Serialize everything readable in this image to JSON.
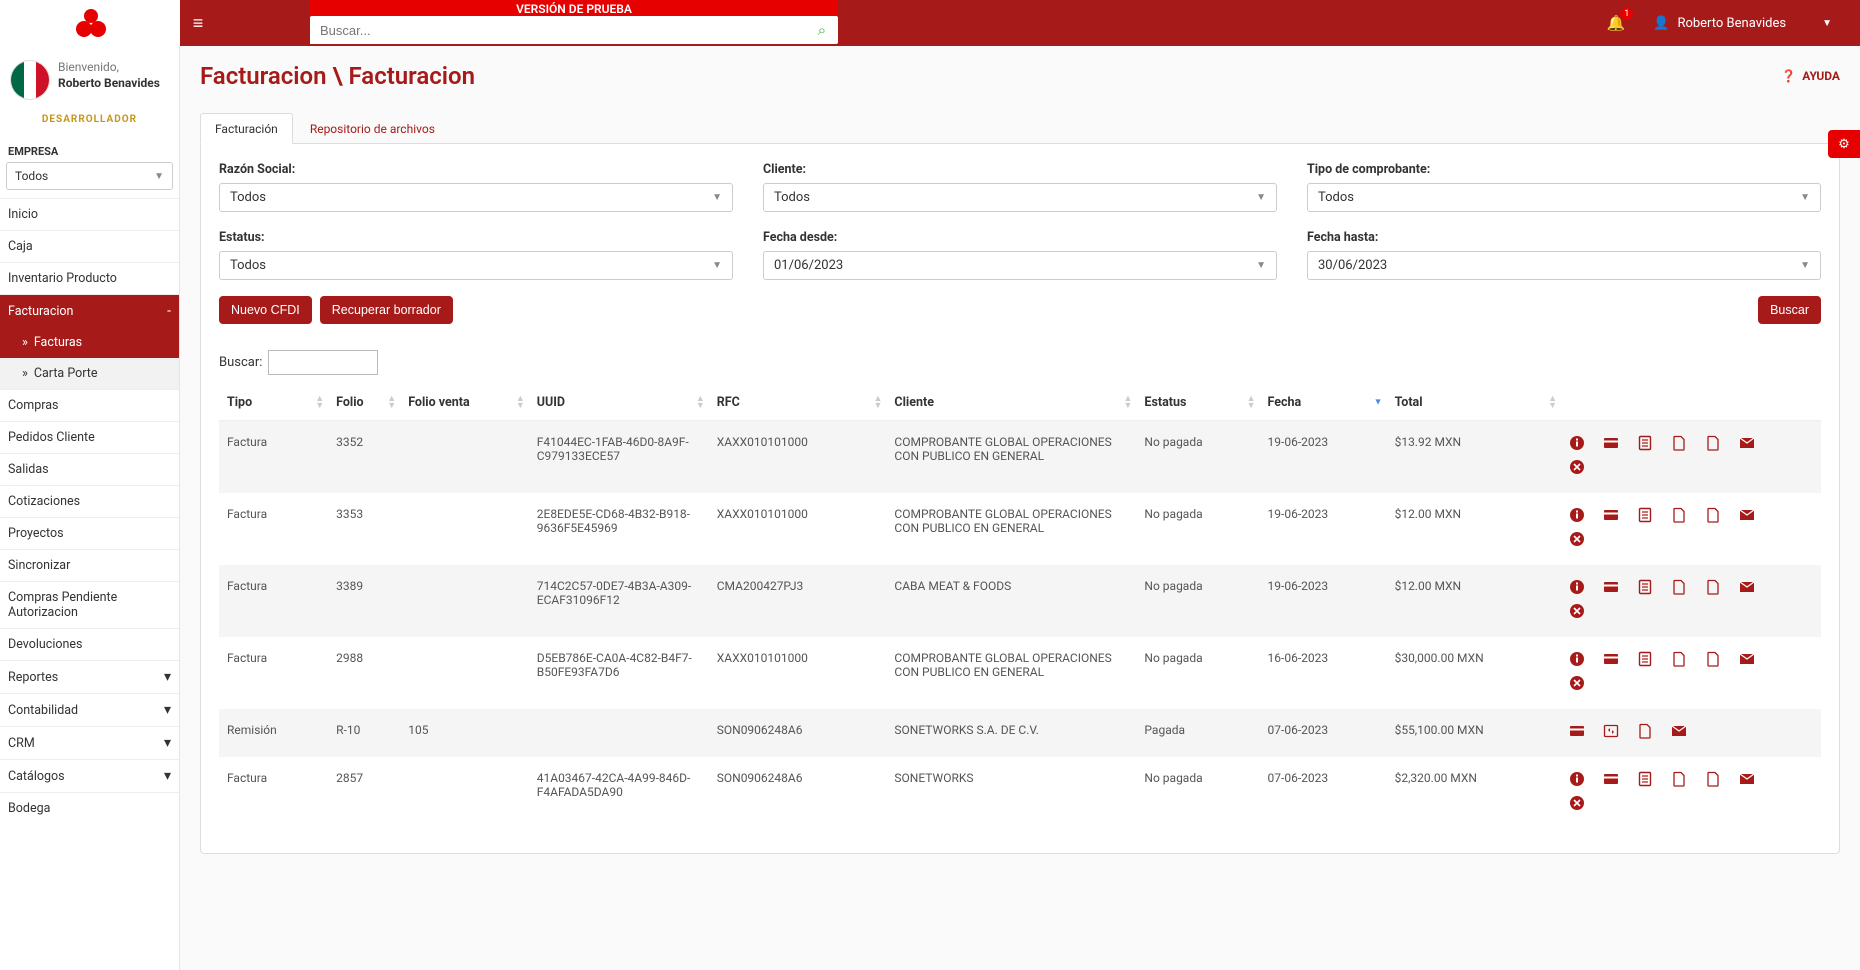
{
  "topbar": {
    "version_banner": "VERSIÓN DE PRUEBA",
    "search_placeholder": "Buscar...",
    "notification_count": "1",
    "user_name": "Roberto Benavides"
  },
  "greeting": {
    "welcome": "Bienvenido,",
    "user_name": "Roberto Benavides",
    "role": "DESARROLLADOR"
  },
  "company": {
    "label": "EMPRESA",
    "value": "Todos"
  },
  "nav": {
    "items": [
      {
        "label": "Inicio",
        "active": false,
        "expand": null
      },
      {
        "label": "Caja",
        "active": false,
        "expand": null
      },
      {
        "label": "Inventario Producto",
        "active": false,
        "expand": null
      },
      {
        "label": "Facturacion",
        "active": true,
        "expand": "-"
      },
      {
        "label": "Compras",
        "active": false,
        "expand": null
      },
      {
        "label": "Pedidos Cliente",
        "active": false,
        "expand": null
      },
      {
        "label": "Salidas",
        "active": false,
        "expand": null
      },
      {
        "label": "Cotizaciones",
        "active": false,
        "expand": null
      },
      {
        "label": "Proyectos",
        "active": false,
        "expand": null
      },
      {
        "label": "Sincronizar",
        "active": false,
        "expand": null
      },
      {
        "label": "Compras Pendiente Autorizacion",
        "active": false,
        "expand": null
      },
      {
        "label": "Devoluciones",
        "active": false,
        "expand": null
      },
      {
        "label": "Reportes",
        "active": false,
        "expand": "▾"
      },
      {
        "label": "Contabilidad",
        "active": false,
        "expand": "▾"
      },
      {
        "label": "CRM",
        "active": false,
        "expand": "▾"
      },
      {
        "label": "Catálogos",
        "active": false,
        "expand": "▾"
      },
      {
        "label": "Bodega",
        "active": false,
        "expand": null
      }
    ],
    "subs": [
      {
        "label": "Facturas",
        "active": true
      },
      {
        "label": "Carta Porte",
        "active": false
      }
    ]
  },
  "breadcrumb": "Facturacion \\ Facturacion",
  "help_label": "AYUDA",
  "tabs": [
    {
      "label": "Facturación",
      "active": true
    },
    {
      "label": "Repositorio de archivos",
      "active": false
    }
  ],
  "filters": {
    "razon": {
      "label": "Razón Social:",
      "value": "Todos"
    },
    "cliente": {
      "label": "Cliente:",
      "value": "Todos"
    },
    "tipo": {
      "label": "Tipo de comprobante:",
      "value": "Todos"
    },
    "estatus": {
      "label": "Estatus:",
      "value": "Todos"
    },
    "desde": {
      "label": "Fecha desde:",
      "value": "01/06/2023"
    },
    "hasta": {
      "label": "Fecha hasta:",
      "value": "30/06/2023"
    }
  },
  "buttons": {
    "nuevo": "Nuevo CFDI",
    "recuperar": "Recuperar borrador",
    "buscar": "Buscar"
  },
  "table_search_label": "Buscar:",
  "columns": {
    "tipo": "Tipo",
    "folio": "Folio",
    "folio_venta": "Folio venta",
    "uuid": "UUID",
    "rfc": "RFC",
    "cliente": "Cliente",
    "estatus": "Estatus",
    "fecha": "Fecha",
    "total": "Total"
  },
  "rows": [
    {
      "tipo": "Factura",
      "folio": "3352",
      "folio_venta": "",
      "uuid": "F41044EC-1FAB-46D0-8A9F-C979133ECE57",
      "rfc": "XAXX010101000",
      "cliente": "COMPROBANTE GLOBAL OPERACIONES CON PUBLICO EN GENERAL",
      "estatus": "No pagada",
      "fecha": "19-06-2023",
      "total": "$13.92 MXN",
      "actions": "full"
    },
    {
      "tipo": "Factura",
      "folio": "3353",
      "folio_venta": "",
      "uuid": "2E8EDE5E-CD68-4B32-B918-9636F5E45969",
      "rfc": "XAXX010101000",
      "cliente": "COMPROBANTE GLOBAL OPERACIONES CON PUBLICO EN GENERAL",
      "estatus": "No pagada",
      "fecha": "19-06-2023",
      "total": "$12.00 MXN",
      "actions": "full"
    },
    {
      "tipo": "Factura",
      "folio": "3389",
      "folio_venta": "",
      "uuid": "714C2C57-0DE7-4B3A-A309-ECAF31096F12",
      "rfc": "CMA200427PJ3",
      "cliente": "CABA MEAT & FOODS",
      "estatus": "No pagada",
      "fecha": "19-06-2023",
      "total": "$12.00 MXN",
      "actions": "full"
    },
    {
      "tipo": "Factura",
      "folio": "2988",
      "folio_venta": "",
      "uuid": "D5EB786E-CA0A-4C82-B4F7-B50FE93FA7D6",
      "rfc": "XAXX010101000",
      "cliente": "COMPROBANTE GLOBAL OPERACIONES CON PUBLICO EN GENERAL",
      "estatus": "No pagada",
      "fecha": "16-06-2023",
      "total": "$30,000.00 MXN",
      "actions": "full"
    },
    {
      "tipo": "Remisión",
      "folio": "R-10",
      "folio_venta": "105",
      "uuid": "",
      "rfc": "SON0906248A6",
      "cliente": "SONETWORKS S.A. DE C.V.",
      "estatus": "Pagada",
      "fecha": "07-06-2023",
      "total": "$55,100.00 MXN",
      "actions": "remision"
    },
    {
      "tipo": "Factura",
      "folio": "2857",
      "folio_venta": "",
      "uuid": "41A03467-42CA-4A99-846D-F4AFADA5DA90",
      "rfc": "SON0906248A6",
      "cliente": "SONETWORKS",
      "estatus": "No pagada",
      "fecha": "07-06-2023",
      "total": "$2,320.00 MXN",
      "actions": "full"
    }
  ]
}
